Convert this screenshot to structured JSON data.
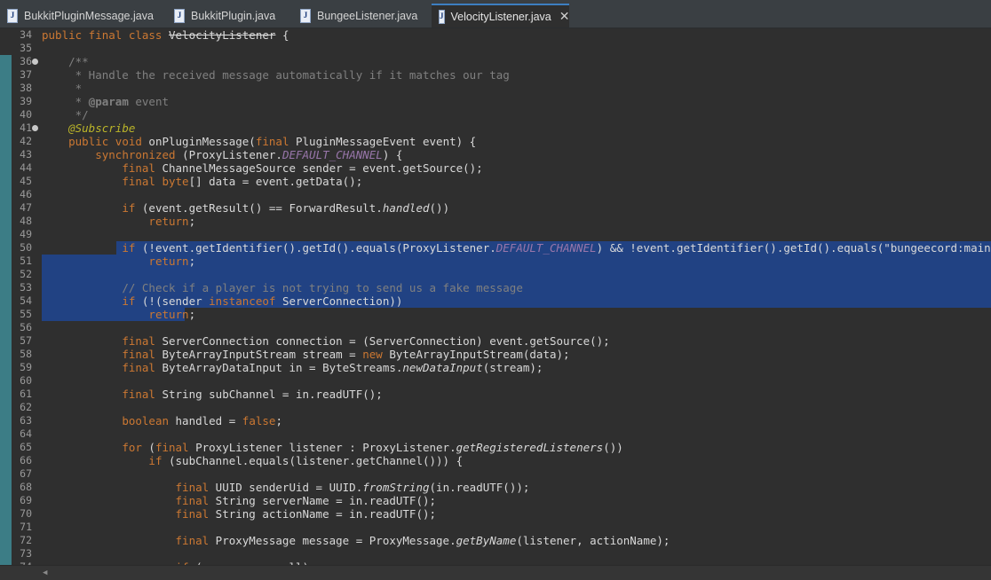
{
  "tabs": [
    {
      "label": "BukkitPluginMessage.java",
      "active": false
    },
    {
      "label": "BukkitPlugin.java",
      "active": false
    },
    {
      "label": "BungeeListener.java",
      "active": false
    },
    {
      "label": "VelocityListener.java",
      "active": true
    }
  ],
  "tab_icon": "java-file-icon",
  "code": {
    "lines": [
      {
        "n": "34",
        "segs": [
          [
            "public final class ",
            "k"
          ],
          [
            "VelocityListener",
            "st"
          ],
          [
            " {",
            ""
          ]
        ]
      },
      {
        "n": "35",
        "segs": []
      },
      {
        "n": "36",
        "fold": true,
        "segs": [
          [
            "    /**",
            "c"
          ]
        ]
      },
      {
        "n": "37",
        "segs": [
          [
            "     * Handle the received message automatically if it matches our tag",
            "c"
          ]
        ]
      },
      {
        "n": "38",
        "segs": [
          [
            "     *",
            "c"
          ]
        ]
      },
      {
        "n": "39",
        "segs": [
          [
            "     * ",
            "c"
          ],
          [
            "@param",
            "cb"
          ],
          [
            " event",
            "c"
          ]
        ]
      },
      {
        "n": "40",
        "segs": [
          [
            "     */",
            "c"
          ]
        ]
      },
      {
        "n": "41",
        "fold": true,
        "segs": [
          [
            "    ",
            ""
          ],
          [
            "@Subscribe",
            "a"
          ]
        ]
      },
      {
        "n": "42",
        "segs": [
          [
            "    ",
            ""
          ],
          [
            "public void ",
            "k"
          ],
          [
            "onPluginMessage(",
            ""
          ],
          [
            "final ",
            "k"
          ],
          [
            "PluginMessageEvent event) {",
            ""
          ]
        ]
      },
      {
        "n": "43",
        "segs": [
          [
            "        ",
            ""
          ],
          [
            "synchronized ",
            "k"
          ],
          [
            "(ProxyListener.",
            ""
          ],
          [
            "DEFAULT_CHANNEL",
            "sf"
          ],
          [
            ") {",
            ""
          ]
        ]
      },
      {
        "n": "44",
        "segs": [
          [
            "            ",
            ""
          ],
          [
            "final ",
            "k"
          ],
          [
            "ChannelMessageSource sender = event.getSource();",
            ""
          ]
        ]
      },
      {
        "n": "45",
        "segs": [
          [
            "            ",
            ""
          ],
          [
            "final ",
            "k"
          ],
          [
            "byte",
            "k"
          ],
          [
            "[] data = event.getData();",
            ""
          ]
        ]
      },
      {
        "n": "46",
        "segs": []
      },
      {
        "n": "47",
        "segs": [
          [
            "            ",
            ""
          ],
          [
            "if ",
            "k"
          ],
          [
            "(event.getResult() == ForwardResult.",
            ""
          ],
          [
            "handled",
            "i"
          ],
          [
            "())",
            ""
          ]
        ]
      },
      {
        "n": "48",
        "segs": [
          [
            "                ",
            ""
          ],
          [
            "return",
            "k"
          ],
          [
            ";",
            ""
          ]
        ]
      },
      {
        "n": "49",
        "segs": []
      },
      {
        "n": "50",
        "sel": "part",
        "segs": [
          [
            "            ",
            ""
          ],
          [
            "if ",
            "k"
          ],
          [
            "(!event.getIdentifier().getId().equals(ProxyListener.",
            ""
          ],
          [
            "DEFAULT_CHANNEL",
            "sf"
          ],
          [
            ") && !event.getIdentifier().getId().equals(\"bungeecord:main\"))",
            ""
          ]
        ]
      },
      {
        "n": "51",
        "sel": "full",
        "segs": [
          [
            "                ",
            ""
          ],
          [
            "return",
            "k"
          ],
          [
            ";",
            ""
          ]
        ]
      },
      {
        "n": "52",
        "sel": "full",
        "segs": []
      },
      {
        "n": "53",
        "sel": "full",
        "segs": [
          [
            "            ",
            ""
          ],
          [
            "// Check if a player is not trying to send us a fake message",
            "c"
          ]
        ]
      },
      {
        "n": "54",
        "sel": "full",
        "segs": [
          [
            "            ",
            ""
          ],
          [
            "if ",
            "k"
          ],
          [
            "(!(sender ",
            ""
          ],
          [
            "instanceof ",
            "k"
          ],
          [
            "ServerConnection))",
            ""
          ]
        ]
      },
      {
        "n": "55",
        "sel": "end",
        "segs": [
          [
            "                ",
            ""
          ],
          [
            "return",
            "k"
          ],
          [
            ";",
            ""
          ]
        ]
      },
      {
        "n": "56",
        "segs": []
      },
      {
        "n": "57",
        "segs": [
          [
            "            ",
            ""
          ],
          [
            "final ",
            "k"
          ],
          [
            "ServerConnection connection = (ServerConnection) event.getSource();",
            ""
          ]
        ]
      },
      {
        "n": "58",
        "segs": [
          [
            "            ",
            ""
          ],
          [
            "final ",
            "k"
          ],
          [
            "ByteArrayInputStream stream = ",
            ""
          ],
          [
            "new ",
            "k"
          ],
          [
            "ByteArrayInputStream(data);",
            ""
          ]
        ]
      },
      {
        "n": "59",
        "segs": [
          [
            "            ",
            ""
          ],
          [
            "final ",
            "k"
          ],
          [
            "ByteArrayDataInput in = ByteStreams.",
            ""
          ],
          [
            "newDataInput",
            "i"
          ],
          [
            "(stream);",
            ""
          ]
        ]
      },
      {
        "n": "60",
        "segs": []
      },
      {
        "n": "61",
        "segs": [
          [
            "            ",
            ""
          ],
          [
            "final ",
            "k"
          ],
          [
            "String subChannel = in.readUTF();",
            ""
          ]
        ]
      },
      {
        "n": "62",
        "segs": []
      },
      {
        "n": "63",
        "segs": [
          [
            "            ",
            ""
          ],
          [
            "boolean ",
            "k"
          ],
          [
            "handled = ",
            ""
          ],
          [
            "false",
            "k"
          ],
          [
            ";",
            ""
          ]
        ]
      },
      {
        "n": "64",
        "segs": []
      },
      {
        "n": "65",
        "segs": [
          [
            "            ",
            ""
          ],
          [
            "for ",
            "k"
          ],
          [
            "(",
            ""
          ],
          [
            "final ",
            "k"
          ],
          [
            "ProxyListener listener : ProxyListener.",
            ""
          ],
          [
            "getRegisteredListeners",
            "i"
          ],
          [
            "())",
            ""
          ]
        ]
      },
      {
        "n": "66",
        "segs": [
          [
            "                ",
            ""
          ],
          [
            "if ",
            "k"
          ],
          [
            "(subChannel.equals(listener.getChannel())) {",
            ""
          ]
        ]
      },
      {
        "n": "67",
        "segs": []
      },
      {
        "n": "68",
        "segs": [
          [
            "                    ",
            ""
          ],
          [
            "final ",
            "k"
          ],
          [
            "UUID senderUid = UUID.",
            ""
          ],
          [
            "fromString",
            "i"
          ],
          [
            "(in.readUTF());",
            ""
          ]
        ]
      },
      {
        "n": "69",
        "segs": [
          [
            "                    ",
            ""
          ],
          [
            "final ",
            "k"
          ],
          [
            "String serverName = in.readUTF();",
            ""
          ]
        ]
      },
      {
        "n": "70",
        "segs": [
          [
            "                    ",
            ""
          ],
          [
            "final ",
            "k"
          ],
          [
            "String actionName = in.readUTF();",
            ""
          ]
        ]
      },
      {
        "n": "71",
        "segs": []
      },
      {
        "n": "72",
        "segs": [
          [
            "                    ",
            ""
          ],
          [
            "final ",
            "k"
          ],
          [
            "ProxyMessage message = ProxyMessage.",
            ""
          ],
          [
            "getByName",
            "i"
          ],
          [
            "(listener, actionName);",
            ""
          ]
        ]
      },
      {
        "n": "73",
        "segs": []
      },
      {
        "n": "74",
        "segs": [
          [
            "                    ",
            ""
          ],
          [
            "if ",
            "k"
          ],
          [
            "(message == null)",
            ""
          ]
        ]
      }
    ]
  },
  "colors": {
    "selection": "#214283",
    "background": "#2f2f2f",
    "keyword": "#cc7832"
  }
}
